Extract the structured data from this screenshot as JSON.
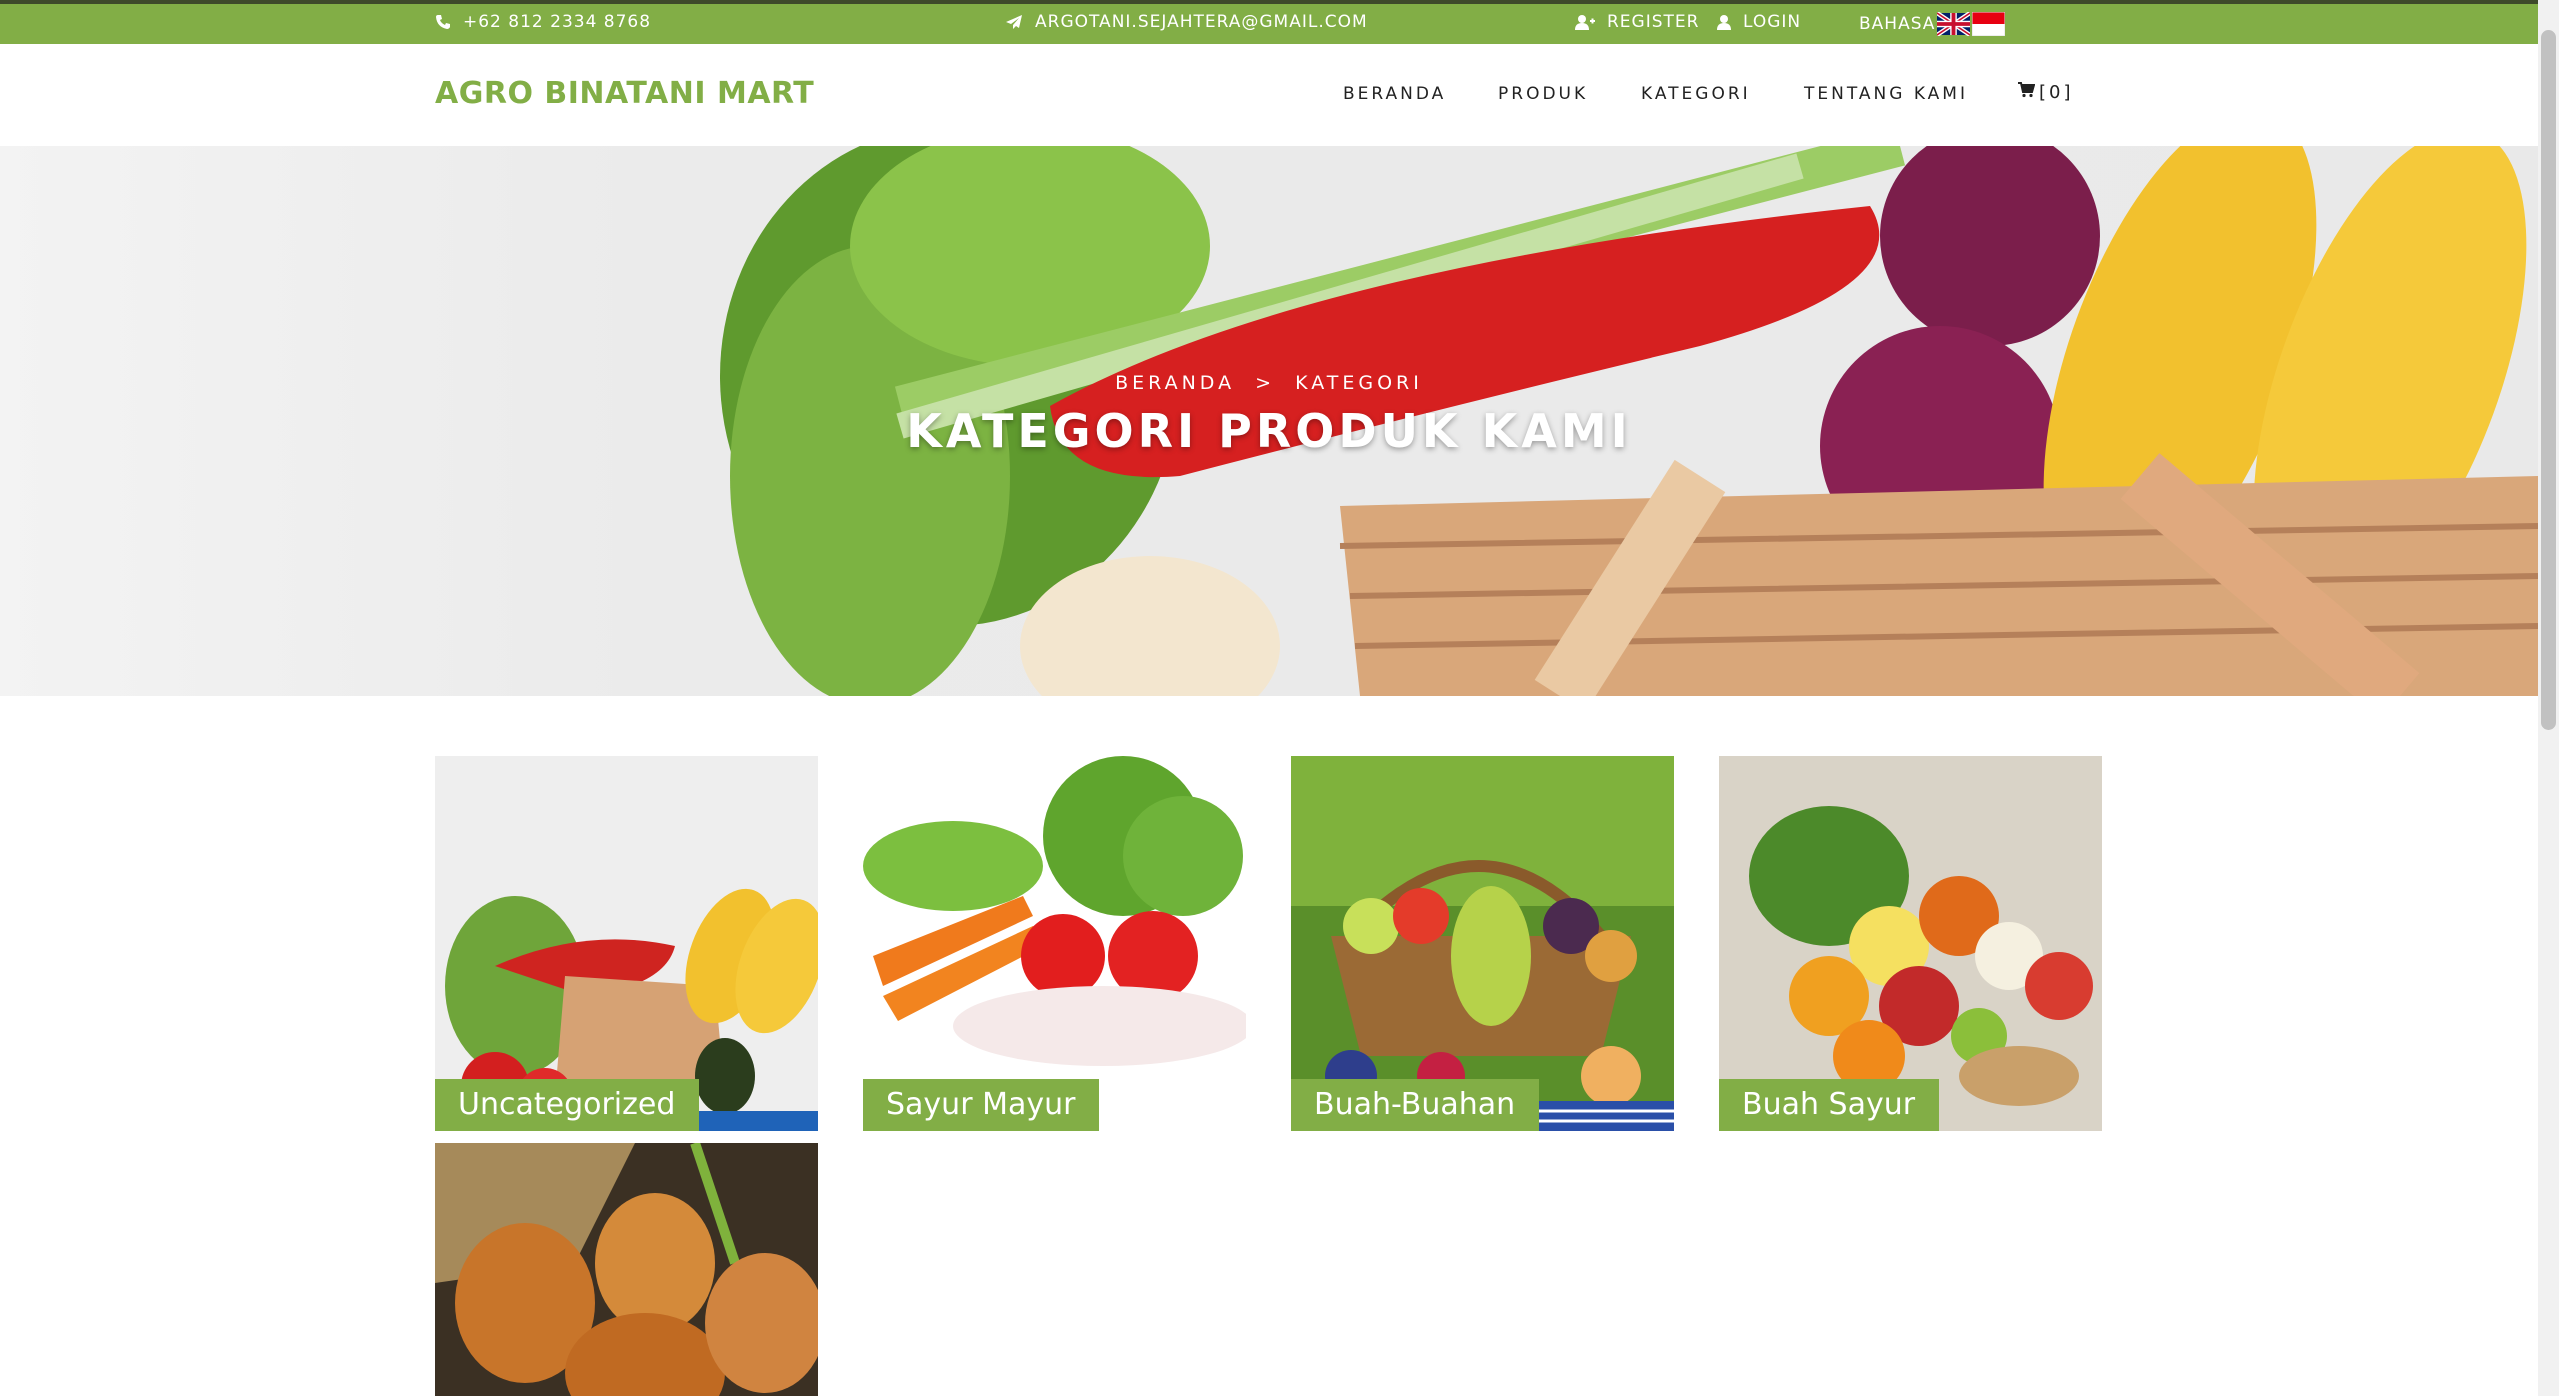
{
  "topbar": {
    "phone": "+62 812 2334 8768",
    "email": "ARGOTANI.SEJAHTERA@GMAIL.COM",
    "register": "REGISTER",
    "login": "LOGIN",
    "language_label": "BAHASA"
  },
  "navbar": {
    "brand": "AGRO BINATANI MART",
    "items": [
      "BERANDA",
      "PRODUK",
      "KATEGORI",
      "TENTANG KAMI"
    ],
    "cart_count": "[0]"
  },
  "hero": {
    "breadcrumb_home": "BERANDA",
    "breadcrumb_sep": ">",
    "breadcrumb_current": "KATEGORI",
    "title": "KATEGORI PRODUK KAMI"
  },
  "categories": [
    {
      "label": "Uncategorized"
    },
    {
      "label": "Sayur Mayur"
    },
    {
      "label": "Buah-Buahan"
    },
    {
      "label": "Buah Sayur"
    },
    {
      "label": ""
    }
  ],
  "colors": {
    "accent": "#82ae46",
    "topbar_border": "#3e4a2a"
  }
}
